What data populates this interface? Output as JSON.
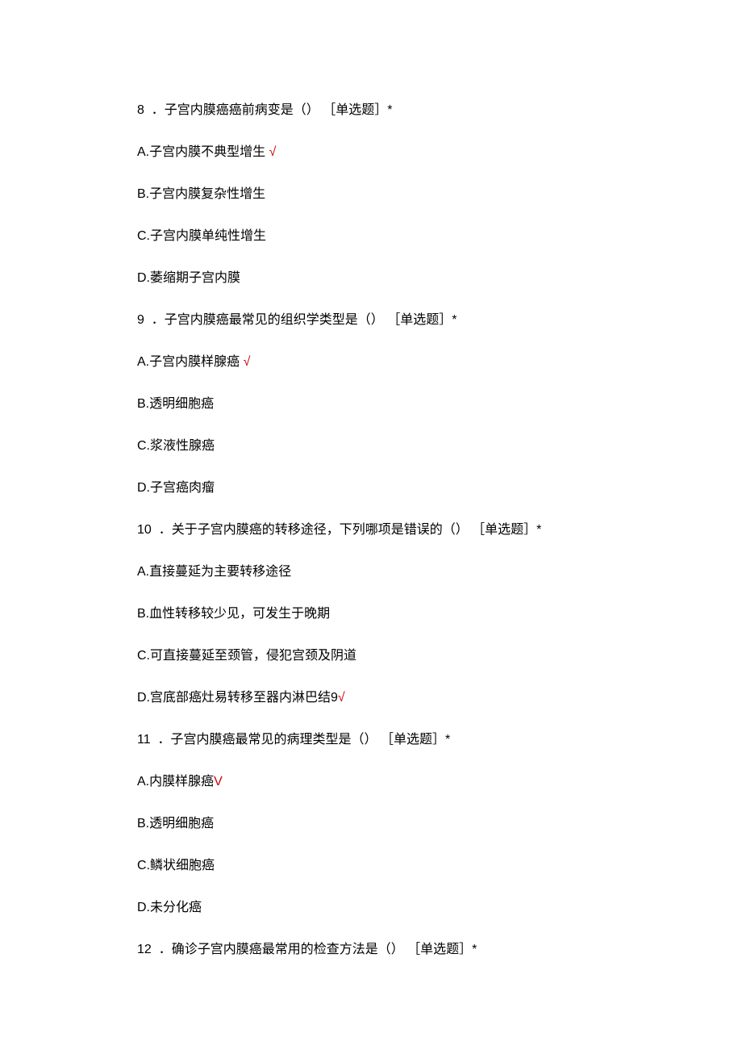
{
  "questions": [
    {
      "num": "8",
      "stem": "．子宫内膜癌癌前病变是（） ［单选题］*",
      "options": [
        {
          "label": "A.子宫内膜不典型增生",
          "correct": true,
          "mark": " √"
        },
        {
          "label": "B.子宫内膜复杂性增生",
          "correct": false,
          "mark": ""
        },
        {
          "label": "C.子宫内膜单纯性增生",
          "correct": false,
          "mark": ""
        },
        {
          "label": "D.萎缩期子宫内膜",
          "correct": false,
          "mark": ""
        }
      ]
    },
    {
      "num": "9",
      "stem": "．子宫内膜癌最常见的组织学类型是（） ［单选题］*",
      "options": [
        {
          "label": "A.子宫内膜样腺癌",
          "correct": true,
          "mark": " √"
        },
        {
          "label": "B.透明细胞癌",
          "correct": false,
          "mark": ""
        },
        {
          "label": "C.浆液性腺癌",
          "correct": false,
          "mark": ""
        },
        {
          "label": "D.子宫癌肉瘤",
          "correct": false,
          "mark": ""
        }
      ]
    },
    {
      "num": "10",
      "stem": "．关于子宫内膜癌的转移途径，下列哪项是错误的（） ［单选题］*",
      "options": [
        {
          "label": "A.直接蔓延为主要转移途径",
          "correct": false,
          "mark": ""
        },
        {
          "label": "B.血性转移较少见，可发生于晚期",
          "correct": false,
          "mark": ""
        },
        {
          "label": "C.可直接蔓延至颈管，侵犯宫颈及阴道",
          "correct": false,
          "mark": ""
        },
        {
          "label": "D.宫底部癌灶易转移至器内淋巴结9",
          "correct": true,
          "mark": "√"
        }
      ]
    },
    {
      "num": "11",
      "stem": "．子宫内膜癌最常见的病理类型是（） ［单选题］*",
      "options": [
        {
          "label": "A.内膜样腺癌",
          "correct": true,
          "mark": "V"
        },
        {
          "label": "B.透明细胞癌",
          "correct": false,
          "mark": ""
        },
        {
          "label": "C.鳞状细胞癌",
          "correct": false,
          "mark": ""
        },
        {
          "label": "D.未分化癌",
          "correct": false,
          "mark": ""
        }
      ]
    },
    {
      "num": "12",
      "stem": "．确诊子宫内膜癌最常用的检查方法是（） ［单选题］*",
      "options": []
    }
  ]
}
